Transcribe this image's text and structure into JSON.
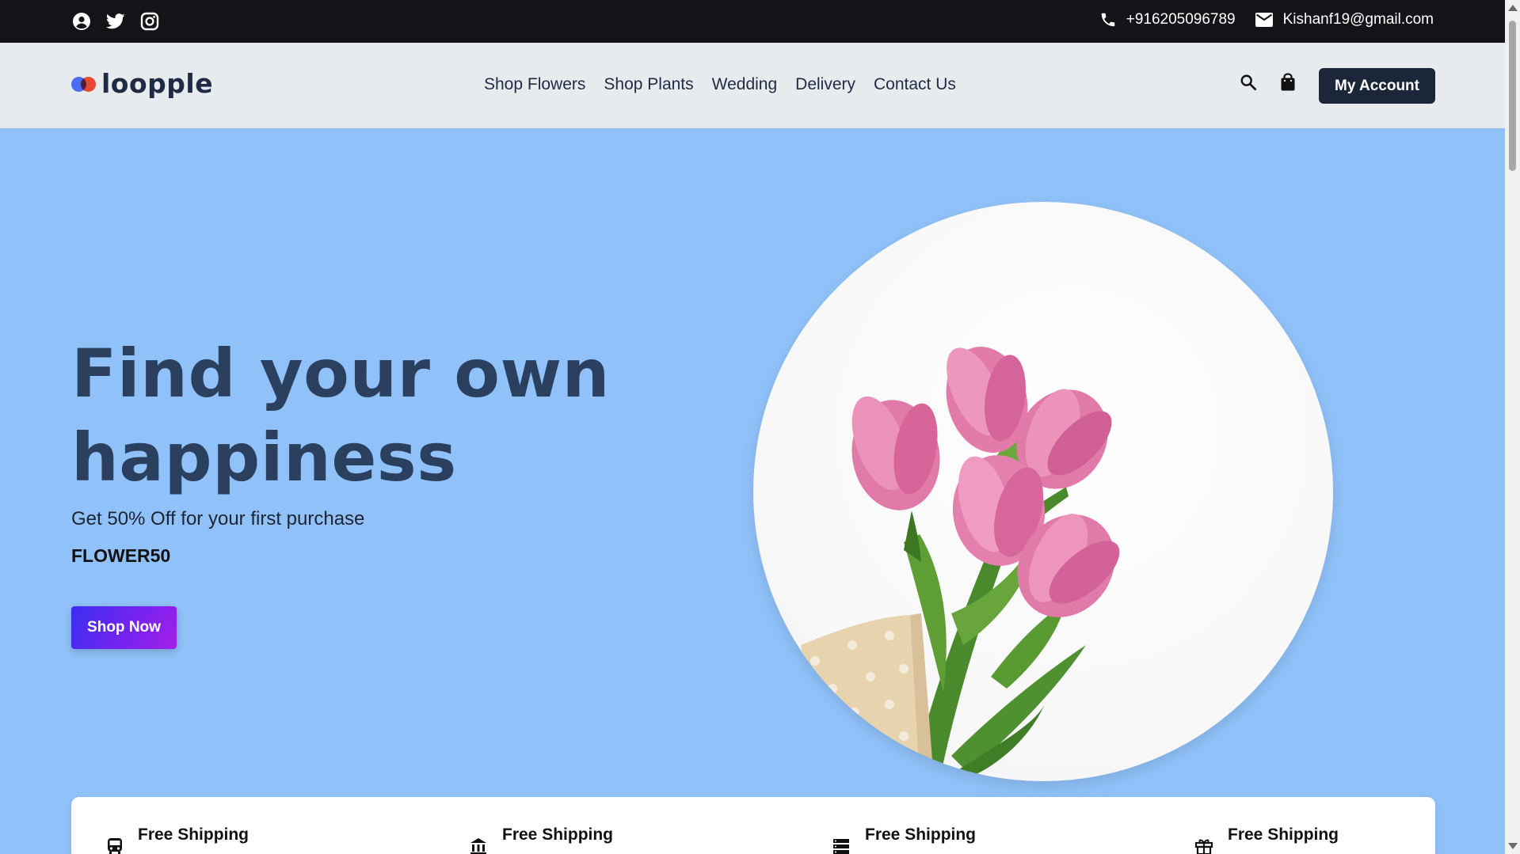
{
  "topbar": {
    "social_icons": [
      "user-circle-icon",
      "twitter-icon",
      "instagram-icon"
    ],
    "phone": "+916205096789",
    "email": "Kishanf19@gmail.com"
  },
  "header": {
    "logo_text": "loopple",
    "nav": [
      "Shop Flowers",
      "Shop Plants",
      "Wedding",
      "Delivery",
      "Contact Us"
    ],
    "account_label": "My Account"
  },
  "hero": {
    "headline": "Find your own happiness",
    "subtitle": "Get 50% Off for your first purchase",
    "promo_code": "FLOWER50",
    "cta_label": "Shop Now"
  },
  "features": [
    {
      "icon": "bus-icon",
      "title": "Free Shipping"
    },
    {
      "icon": "bank-icon",
      "title": "Free Shipping"
    },
    {
      "icon": "server-icon",
      "title": "Free Shipping"
    },
    {
      "icon": "gift-icon",
      "title": "Free Shipping"
    }
  ],
  "colors": {
    "topbar_bg": "#131418",
    "header_bg": "#e8ebee",
    "hero_bg": "#90c2f9",
    "headline": "#2b3f5f",
    "account_btn": "#1b2638",
    "logo_blue": "#4a6cf7",
    "logo_red": "#ff4e3a"
  }
}
